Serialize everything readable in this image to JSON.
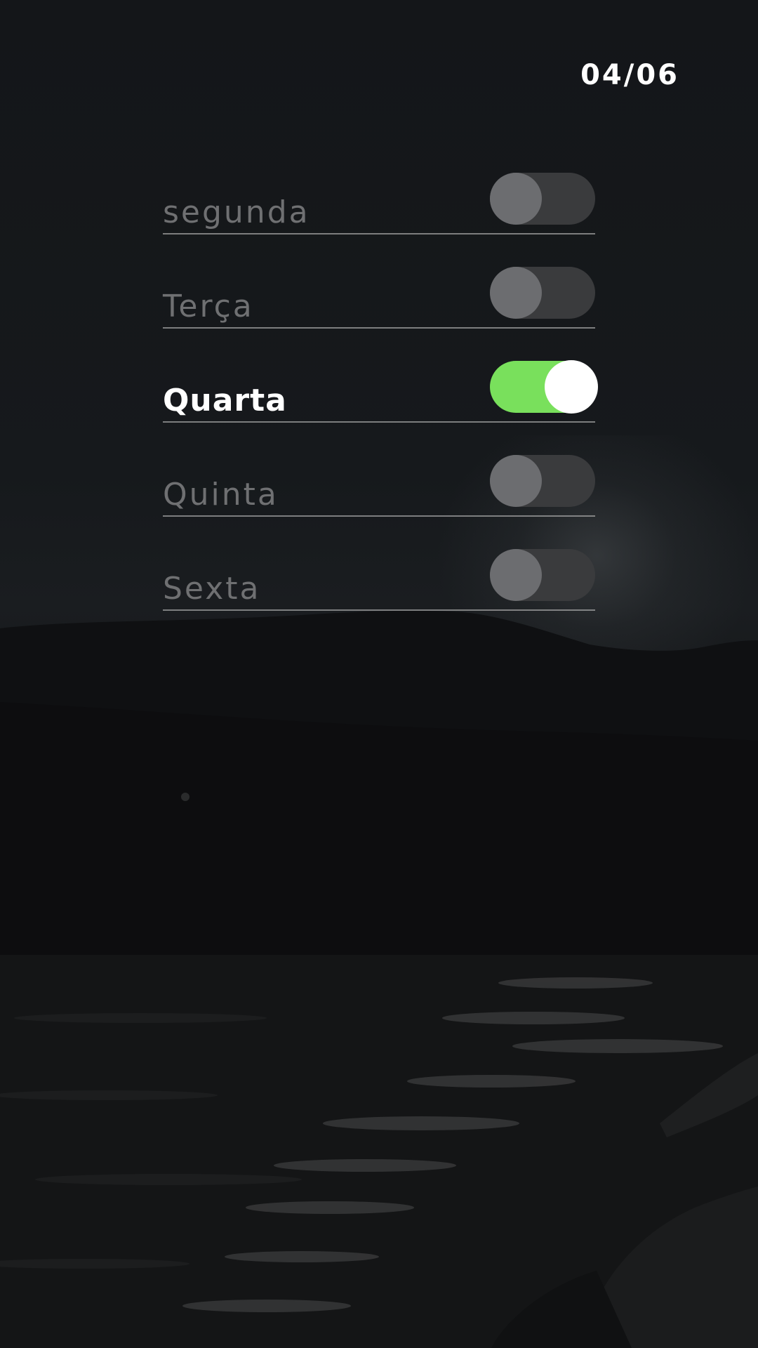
{
  "counter": "04/06",
  "days": [
    {
      "label": "segunda",
      "enabled": false
    },
    {
      "label": "Terça",
      "enabled": false
    },
    {
      "label": "Quarta",
      "enabled": true
    },
    {
      "label": "Quinta",
      "enabled": false
    },
    {
      "label": "Sexta",
      "enabled": false
    }
  ],
  "colors": {
    "toggle_on": "#79e05c",
    "toggle_off": "#3a3b3d",
    "label_active": "#ffffff",
    "label_inactive": "#6f7072"
  }
}
